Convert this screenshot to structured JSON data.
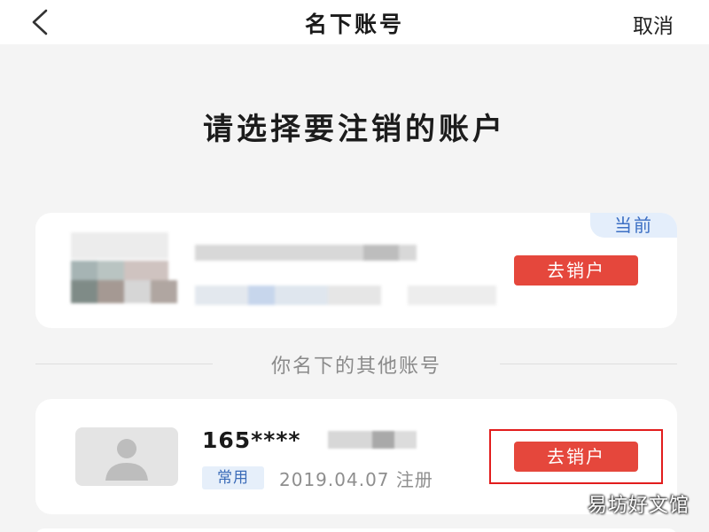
{
  "header": {
    "back_icon": "chevron-left-icon",
    "title": "名下账号",
    "cancel_label": "取消"
  },
  "page": {
    "heading": "请选择要注销的账户"
  },
  "current_account": {
    "badge": "当前",
    "deactivate_label": "去销户"
  },
  "divider": {
    "label": "你名下的其他账号"
  },
  "other_accounts": [
    {
      "avatar_icon": "default-avatar-icon",
      "phone": "165****",
      "tag": "常用",
      "registered": "2019.04.07 注册",
      "deactivate_label": "去销户"
    }
  ],
  "watermark": "易坊好文馆",
  "colors": {
    "accent": "#e5473c",
    "highlight_border": "#e21d1d",
    "badge_text": "#3c6fc4",
    "badge_bg": "#e4eefb"
  }
}
